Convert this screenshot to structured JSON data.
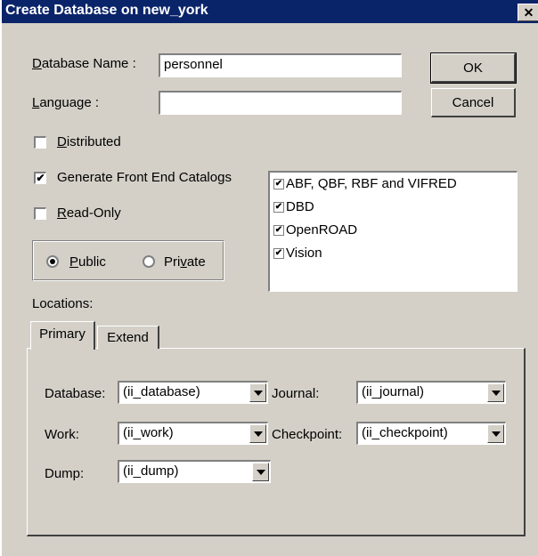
{
  "title": "Create Database on new_york",
  "close_glyph": "✕",
  "fields": {
    "db_name": {
      "label_ul": "D",
      "label_rest": "atabase Name :",
      "value": "personnel"
    },
    "language": {
      "label_ul": "L",
      "label_rest": "anguage :",
      "value": ""
    }
  },
  "buttons": {
    "ok": "OK",
    "cancel": "Cancel"
  },
  "options": {
    "distributed": {
      "label_ul": "D",
      "label_rest": "istributed",
      "checked": false
    },
    "front_end": {
      "label": "Generate Front End Catalogs",
      "checked": true
    },
    "read_only": {
      "label_ul": "R",
      "label_rest": "ead-Only",
      "checked": false
    }
  },
  "access": {
    "public": {
      "label_ul": "P",
      "label_rest": "ublic",
      "selected": true
    },
    "private": {
      "label_pre": "Pri",
      "label_ul": "v",
      "label_rest": "ate",
      "selected": false
    }
  },
  "catalogs": [
    {
      "label": "ABF, QBF, RBF and VIFRED",
      "checked": true
    },
    {
      "label": "DBD",
      "checked": true
    },
    {
      "label": "OpenROAD",
      "checked": true
    },
    {
      "label": "Vision",
      "checked": true
    }
  ],
  "locations_label": "Locations:",
  "tabs": {
    "primary": "Primary",
    "extend": "Extend"
  },
  "locations": {
    "database": {
      "label": "Database:",
      "value": "(ii_database)"
    },
    "journal": {
      "label": "Journal:",
      "value": "(ii_journal)"
    },
    "work": {
      "label": "Work:",
      "value": "(ii_work)"
    },
    "checkpoint": {
      "label": "Checkpoint:",
      "value": "(ii_checkpoint)"
    },
    "dump": {
      "label": "Dump:",
      "value": "(ii_dump)"
    }
  },
  "check_glyph": "✔"
}
